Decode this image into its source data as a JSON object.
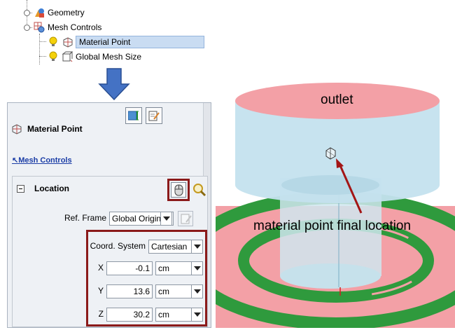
{
  "tree": {
    "items": [
      {
        "label": "Geometry",
        "icon": "geometry-icon"
      },
      {
        "label": "Mesh Controls",
        "icon": "mesh-controls-icon"
      },
      {
        "label": "Material Point",
        "icon": "material-point-icon",
        "selected": true
      },
      {
        "label": "Global Mesh Size",
        "icon": "global-mesh-size-icon"
      }
    ]
  },
  "panel": {
    "title": "Material Point",
    "link": "↖Mesh Controls",
    "section_title": "Location",
    "ref_frame_label": "Ref. Frame",
    "ref_frame_value": "Global Origin",
    "coord_system_label": "Coord. System",
    "coord_system_value": "Cartesian",
    "fields": [
      {
        "label": "X",
        "value": "-0.1",
        "unit": "cm"
      },
      {
        "label": "Y",
        "value": "13.6",
        "unit": "cm"
      },
      {
        "label": "Z",
        "value": "30.2",
        "unit": "cm"
      }
    ]
  },
  "view": {
    "outlet_label": "outlet",
    "annotation": "material point final location"
  },
  "colors": {
    "highlight_box": "#8b1a1a",
    "arrow_blue": "#3a6fc4",
    "outlet_pink": "#f3a0a6",
    "ring_green": "#2f9a3d",
    "cylinder_blue": "#bfe0ee"
  }
}
